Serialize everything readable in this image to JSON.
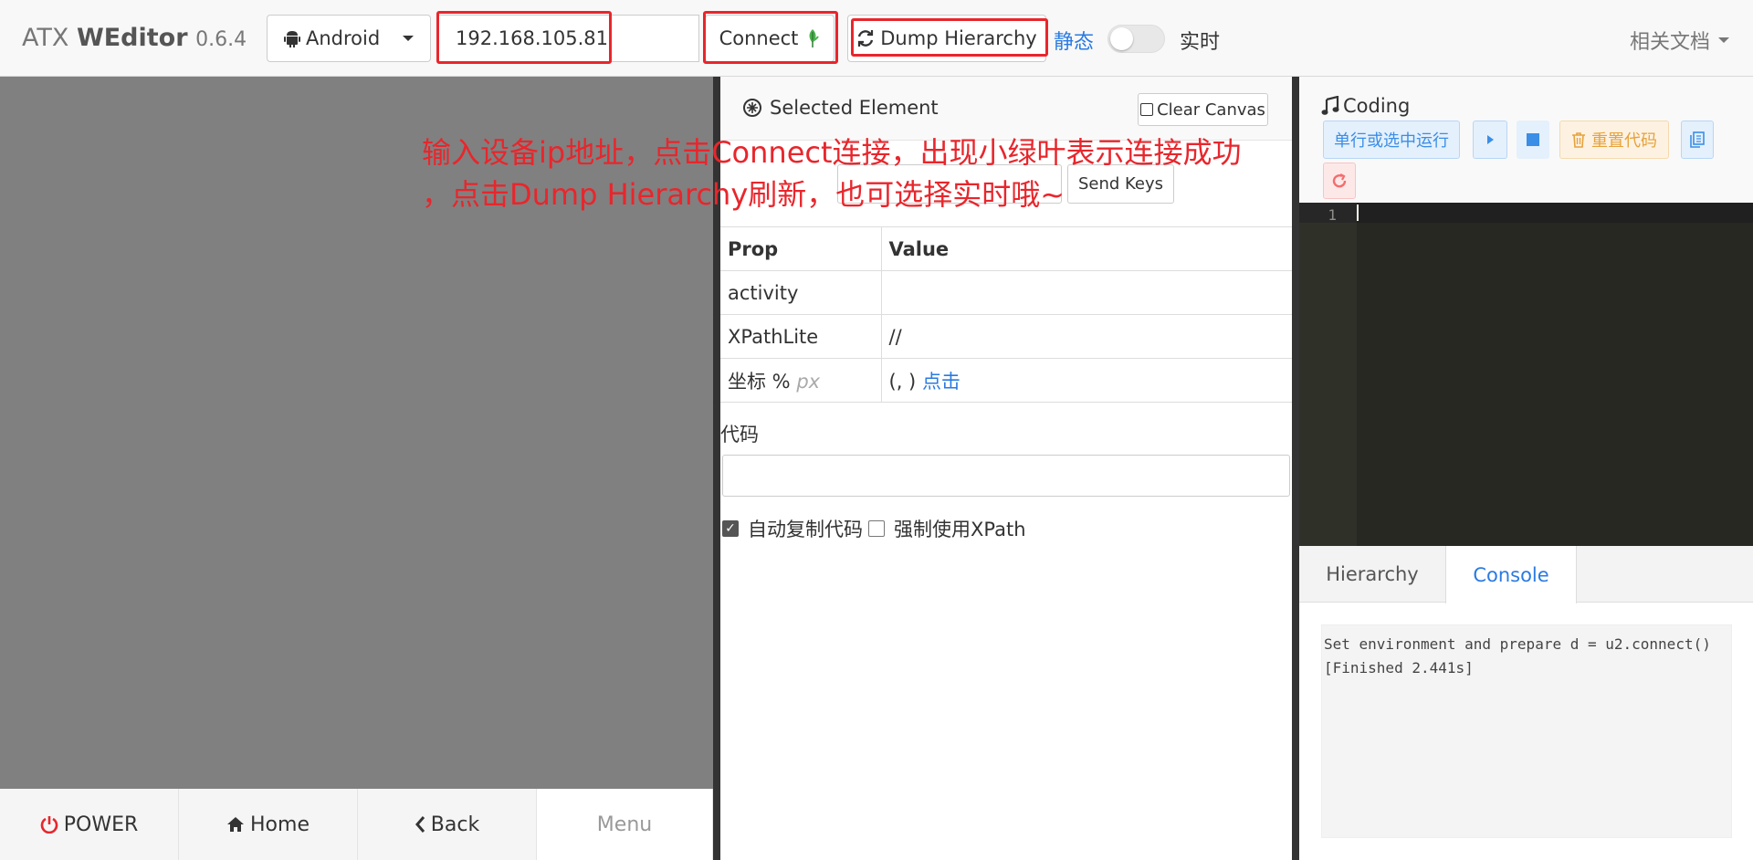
{
  "navbar": {
    "brand_prefix": "ATX ",
    "brand_bold": "WEditor",
    "brand_version": "0.6.4",
    "platform_select": "Android",
    "ip_value": "192.168.105.81",
    "connect_label": "Connect",
    "dump_label": "Dump Hierarchy",
    "static_label": "静态",
    "realtime_label": "实时",
    "docs_label": "相关文档"
  },
  "device_buttons": {
    "power": "POWER",
    "home": "Home",
    "back": "Back",
    "menu": "Menu"
  },
  "selected": {
    "title": "Selected Element",
    "clear_canvas": "Clear Canvas",
    "send_keys": "Send Keys",
    "col_prop": "Prop",
    "col_value": "Value",
    "rows": [
      {
        "prop": "activity",
        "value": ""
      },
      {
        "prop": "XPathLite",
        "value": "//"
      }
    ],
    "coord_prop": "坐标 %",
    "coord_px": "px",
    "coord_value": "(, )",
    "coord_link": "点击",
    "code_label": "代码",
    "auto_copy": "自动复制代码",
    "force_xpath": "强制使用XPath"
  },
  "coding": {
    "title": "Coding",
    "run_label": "单行或选中运行",
    "reset_label": "重置代码",
    "line_number": "1",
    "tab_hierarchy": "Hierarchy",
    "tab_console": "Console",
    "console_text": "Set environment and prepare d = u2.connect()\n[Finished 2.441s]"
  },
  "annotation": {
    "line1": "输入设备ip地址，点击Connect连接，出现小绿叶表示连接成功",
    "line2": "，点击Dump Hierarchy刷新，也可选择实时哦~"
  },
  "colors": {
    "highlight": "#e8262c",
    "link": "#2a7ae2",
    "leaf_green": "#4caf50",
    "editor_bg": "#272822",
    "device_bg": "#808080"
  }
}
